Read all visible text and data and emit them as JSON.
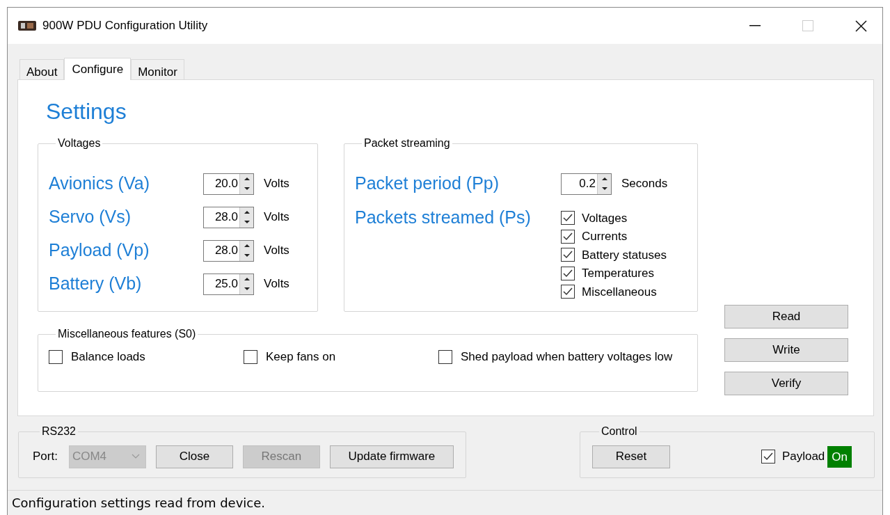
{
  "window": {
    "title": "900W PDU Configuration Utility"
  },
  "tabs": [
    {
      "label": "About",
      "selected": false
    },
    {
      "label": "Configure",
      "selected": true
    },
    {
      "label": "Monitor",
      "selected": false
    }
  ],
  "settings": {
    "title": "Settings"
  },
  "voltages": {
    "title": "Voltages",
    "rows": [
      {
        "label": "Avionics (Va)",
        "value": "20.0",
        "unit": "Volts"
      },
      {
        "label": "Servo (Vs)",
        "value": "28.0",
        "unit": "Volts"
      },
      {
        "label": "Payload (Vp)",
        "value": "28.0",
        "unit": "Volts"
      },
      {
        "label": "Battery (Vb)",
        "value": "25.0",
        "unit": "Volts"
      }
    ]
  },
  "packet_streaming": {
    "title": "Packet streaming",
    "period": {
      "label": "Packet period (Pp)",
      "value": "0.2",
      "unit": "Seconds"
    },
    "streamed": {
      "label": "Packets streamed (Ps)",
      "options": [
        {
          "label": "Voltages",
          "checked": true
        },
        {
          "label": "Currents",
          "checked": true
        },
        {
          "label": "Battery statuses",
          "checked": true
        },
        {
          "label": "Temperatures",
          "checked": true
        },
        {
          "label": "Miscellaneous",
          "checked": true
        }
      ]
    }
  },
  "misc_features": {
    "title": "Miscellaneous features (S0)",
    "options": [
      {
        "label": "Balance loads",
        "checked": false
      },
      {
        "label": "Keep fans on",
        "checked": false
      },
      {
        "label": "Shed payload when battery voltages low",
        "checked": false
      }
    ]
  },
  "actions": [
    "Read",
    "Write",
    "Verify"
  ],
  "rs232": {
    "title": "RS232",
    "port_label": "Port:",
    "port": {
      "value": "COM4",
      "disabled": true
    },
    "buttons": [
      {
        "label": "Close",
        "disabled": false
      },
      {
        "label": "Rescan",
        "disabled": true
      },
      {
        "label": "Update firmware",
        "disabled": false
      }
    ]
  },
  "control": {
    "title": "Control",
    "reset": "Reset",
    "payload": {
      "label": "Payload",
      "checked": true,
      "status": "On",
      "on": true
    }
  },
  "status_bar": "Configuration settings read from device."
}
